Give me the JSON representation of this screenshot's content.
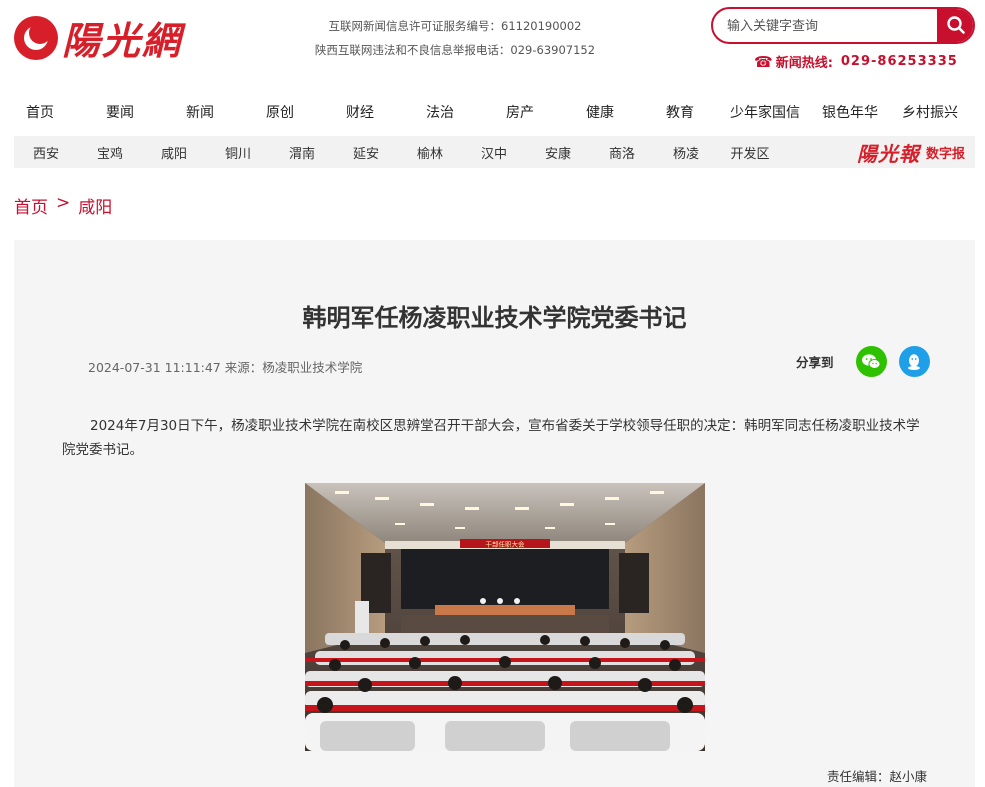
{
  "site": {
    "logo_text": "陽光網",
    "license_line1": "互联网新闻信息许可证服务编号：61120190002",
    "license_line2": "陕西互联网违法和不良信息举报电话：029-63907152"
  },
  "search": {
    "placeholder": "输入关键字查询"
  },
  "hotline": {
    "label": "新闻热线:",
    "number": "029-86253335"
  },
  "main_nav": [
    "首页",
    "要闻",
    "新闻",
    "原创",
    "财经",
    "法治",
    "房产",
    "健康",
    "教育",
    "少年家国信",
    "银色年华",
    "乡村振兴"
  ],
  "sub_nav": [
    "西安",
    "宝鸡",
    "咸阳",
    "铜川",
    "渭南",
    "延安",
    "榆林",
    "汉中",
    "安康",
    "商洛",
    "杨凌",
    "开发区"
  ],
  "digital_paper": {
    "brand": "陽光報",
    "label": "数字报"
  },
  "breadcrumb": {
    "home": "首页",
    "separator": ">",
    "current": "咸阳"
  },
  "article": {
    "title": "韩明军任杨凌职业技术学院党委书记",
    "meta": "2024-07-31 11:11:47 来源：杨凌职业技术学院",
    "share_label": "分享到",
    "body": "2024年7月30日下午，杨凌职业技术学院在南校区思辨堂召开干部大会，宣布省委关于学校领导任职的决定：韩明军同志任杨凌职业技术学院党委书记。",
    "banner_text": "干部任职大会",
    "editor": "责任编辑：赵小康"
  },
  "colors": {
    "brand_red": "#c8102e",
    "wechat_green": "#2dc100",
    "qq_blue": "#1e9fe8"
  }
}
